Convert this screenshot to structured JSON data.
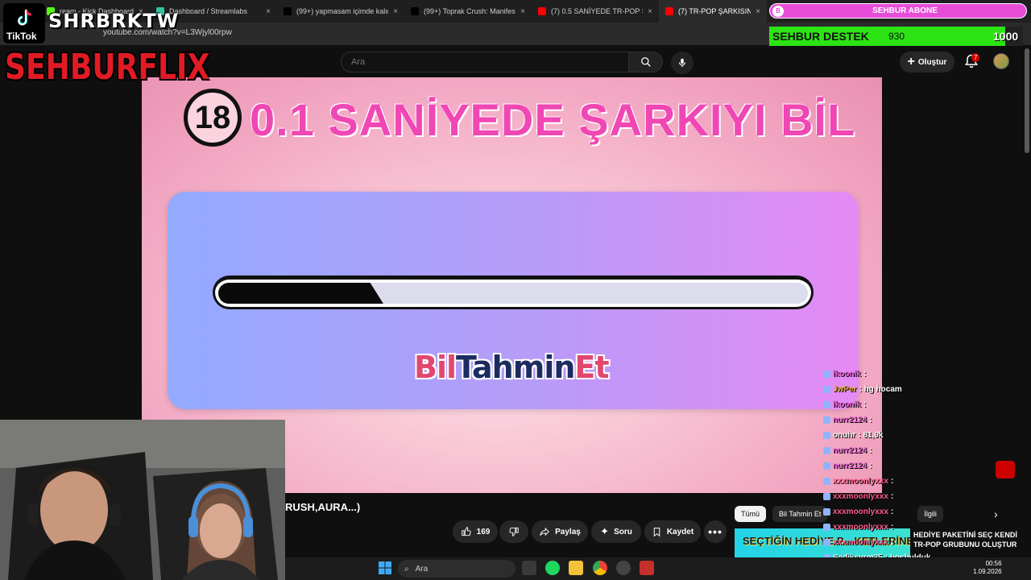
{
  "tabs": [
    {
      "title": "ream - Kick Dashboard",
      "color": "#53fc18"
    },
    {
      "title": "Dashboard / Streamlabs",
      "color": "#31c3a2"
    },
    {
      "title": "(99+) yapmasam içimde kalırdı",
      "color": "#000000"
    },
    {
      "title": "(99+) Toprak Crush: Manifest ve",
      "color": "#000000"
    },
    {
      "title": "(7) 0.5 SANİYEDE TR-POP ŞARK",
      "color": "#ff0000"
    },
    {
      "title": "(7) TR-POP ŞARKISINI 0.1 S",
      "color": "#ff0000"
    }
  ],
  "address": {
    "url": "youtube.com/watch?v=L3Wjyl00rpw"
  },
  "youtube": {
    "search_placeholder": "Ara",
    "create_label": "Oluştur",
    "notifications": "7"
  },
  "video": {
    "level": "18",
    "title": "0.1 SANİYEDE ŞARKIYI BİL",
    "progress": 0.28,
    "brand_parts": [
      "Bil",
      "Tahmin",
      "Et"
    ]
  },
  "below": {
    "title_fragment": "RUSH,AURA...)",
    "likes": "169",
    "share": "Paylaş",
    "ask": "Soru",
    "save": "Kaydet",
    "chips": [
      "Tümü",
      "Bil Tahmin Et",
      "İlgili"
    ],
    "thumb_text": "SEÇTİĞİN HEDİYE P... KETLERİNE GÖRE",
    "rec_title": "HEDİYE PAKETİNİ SEÇ KENDİ TR-POP GRUBUNU OLUŞTUR"
  },
  "overlays": {
    "tiktok_label": "TikTok",
    "tiktok_name": "SHRBRKTW",
    "brand": "SEHBURFLIX",
    "sub_goal_label": "SEHBUR ABONE",
    "sub_goal_icon": "B",
    "donate_label": "SEHBUR DESTEK",
    "donate_current": "930",
    "donate_goal": "1000",
    "donate_progress": 0.93,
    "accent_red": "#e01b24",
    "accent_green": "#2ce414",
    "accent_pink": "#e84dd8"
  },
  "chat": [
    {
      "user": "ikoonik",
      "text": "",
      "color": "#e05cd0"
    },
    {
      "user": "JwPer",
      "text": "hg hocam",
      "color": "#e2a93b"
    },
    {
      "user": "ikoonik",
      "text": "",
      "color": "#e05cd0"
    },
    {
      "user": "nurr2124",
      "text": "",
      "color": "#e05cd0"
    },
    {
      "user": "onuhr",
      "text": "81,9k",
      "color": "#f1f1f1"
    },
    {
      "user": "nurr2124",
      "text": "",
      "color": "#e05cd0"
    },
    {
      "user": "nurr2124",
      "text": "",
      "color": "#e05cd0"
    },
    {
      "user": "xxxmoonlyxxx",
      "text": "",
      "color": "#ff5b8a"
    },
    {
      "user": "xxxmoonlyxxx",
      "text": "",
      "color": "#ff5b8a"
    },
    {
      "user": "xxxmoonlyxxx",
      "text": "",
      "color": "#ff5b8a"
    },
    {
      "user": "xxxmoonlyxxx",
      "text": "",
      "color": "#ff5b8a"
    },
    {
      "user": "xxxmoonlyxxx",
      "text": "",
      "color": "#ff5b8a"
    },
    {
      "user": "Sadiksvrm35",
      "text": "hoşbulduk",
      "color": "#f1f1f1"
    }
  ],
  "taskbar": {
    "search": "Ara",
    "time": "00:56",
    "date": "1.09.2026"
  }
}
